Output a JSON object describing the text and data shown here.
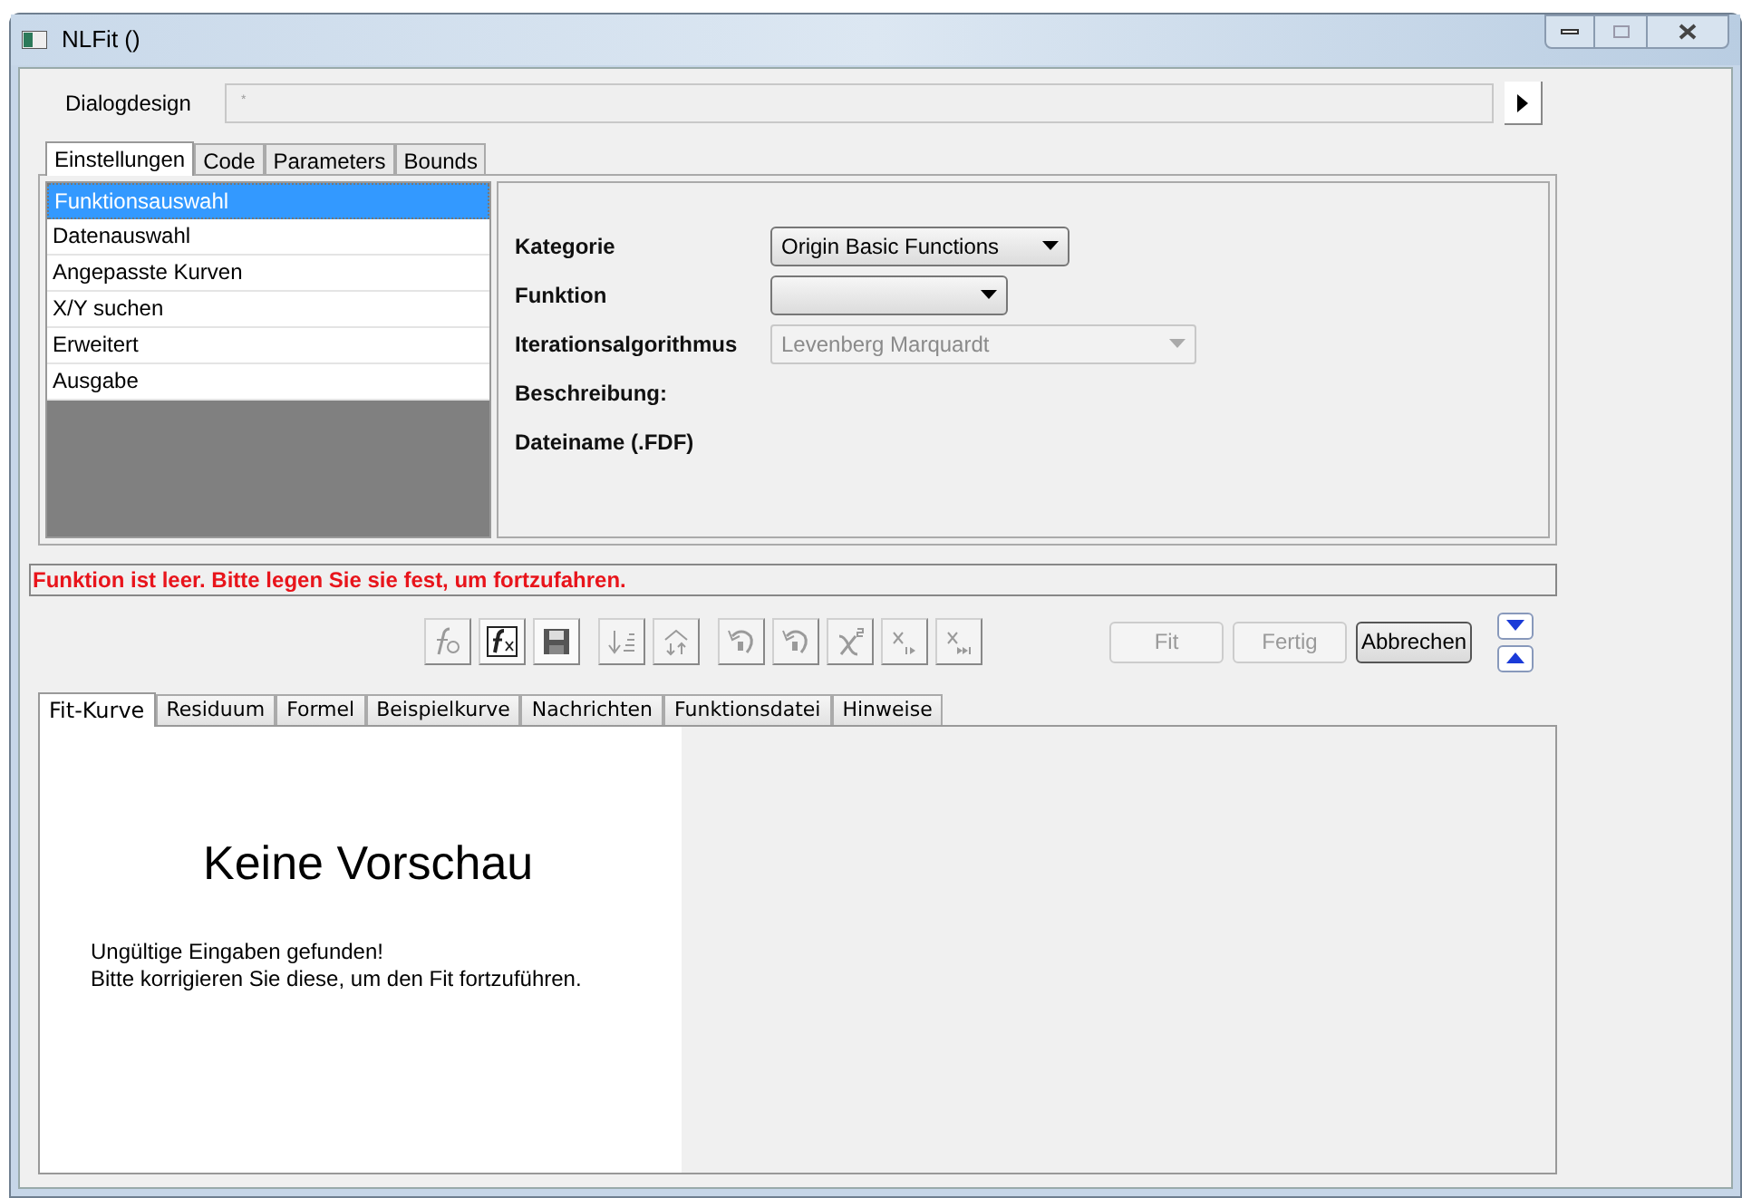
{
  "window": {
    "title": "NLFit ()"
  },
  "dialog_design": {
    "label": "Dialogdesign",
    "placeholder": "*"
  },
  "tabs": [
    {
      "label": "Einstellungen",
      "selected": true
    },
    {
      "label": "Code",
      "selected": false
    },
    {
      "label": "Parameters",
      "selected": false
    },
    {
      "label": "Bounds",
      "selected": false
    }
  ],
  "nav_items": [
    {
      "label": "Funktionsauswahl",
      "selected": true
    },
    {
      "label": "Datenauswahl",
      "selected": false
    },
    {
      "label": "Angepasste Kurven",
      "selected": false
    },
    {
      "label": "X/Y suchen",
      "selected": false
    },
    {
      "label": "Erweitert",
      "selected": false
    },
    {
      "label": "Ausgabe",
      "selected": false
    }
  ],
  "settings": [
    {
      "kind": "dropdown",
      "label": "Kategorie",
      "value": "Origin Basic Functions",
      "disabled": false
    },
    {
      "kind": "dropdown",
      "label": "Funktion",
      "disabled": false
    },
    {
      "kind": "dropdown",
      "label": "Iterationsalgorithmus",
      "value": "Levenberg Marquardt",
      "disabled": true
    },
    {
      "kind": "label",
      "label": "Beschreibung:"
    },
    {
      "kind": "label",
      "label": "Dateiname (.FDF)"
    }
  ],
  "message": "Funktion ist leer. Bitte legen Sie sie fest, um fortzufahren.",
  "toolbar": [
    [
      {
        "kind": "new-function",
        "disabled": true
      },
      {
        "kind": "edit-function",
        "disabled": false
      },
      {
        "kind": "save",
        "disabled": false
      }
    ],
    [
      {
        "kind": "sort",
        "disabled": true
      },
      {
        "kind": "tree",
        "disabled": true
      }
    ],
    [
      {
        "kind": "undo",
        "disabled": true
      },
      {
        "kind": "undo",
        "disabled": true
      },
      {
        "kind": "chi-square",
        "disabled": true
      },
      {
        "kind": "step",
        "disabled": true
      },
      {
        "kind": "step-all",
        "disabled": true
      }
    ]
  ],
  "actions": [
    {
      "label": "Fit",
      "disabled": true
    },
    {
      "label": "Fertig",
      "disabled": true
    },
    {
      "label": "Abbrechen",
      "disabled": false
    }
  ],
  "preview_tabs": [
    {
      "label": "Fit-Kurve",
      "selected": true
    },
    {
      "label": "Residuum",
      "selected": false
    },
    {
      "label": "Formel",
      "selected": false
    },
    {
      "label": "Beispielkurve",
      "selected": false
    },
    {
      "label": "Nachrichten",
      "selected": false
    },
    {
      "label": "Funktionsdatei",
      "selected": false
    },
    {
      "label": "Hinweise",
      "selected": false
    }
  ],
  "preview": {
    "heading": "Keine Vorschau",
    "lines": [
      "Ungültige Eingaben gefunden!",
      "Bitte korrigieren Sie diese, um den Fit fortzuführen."
    ]
  }
}
